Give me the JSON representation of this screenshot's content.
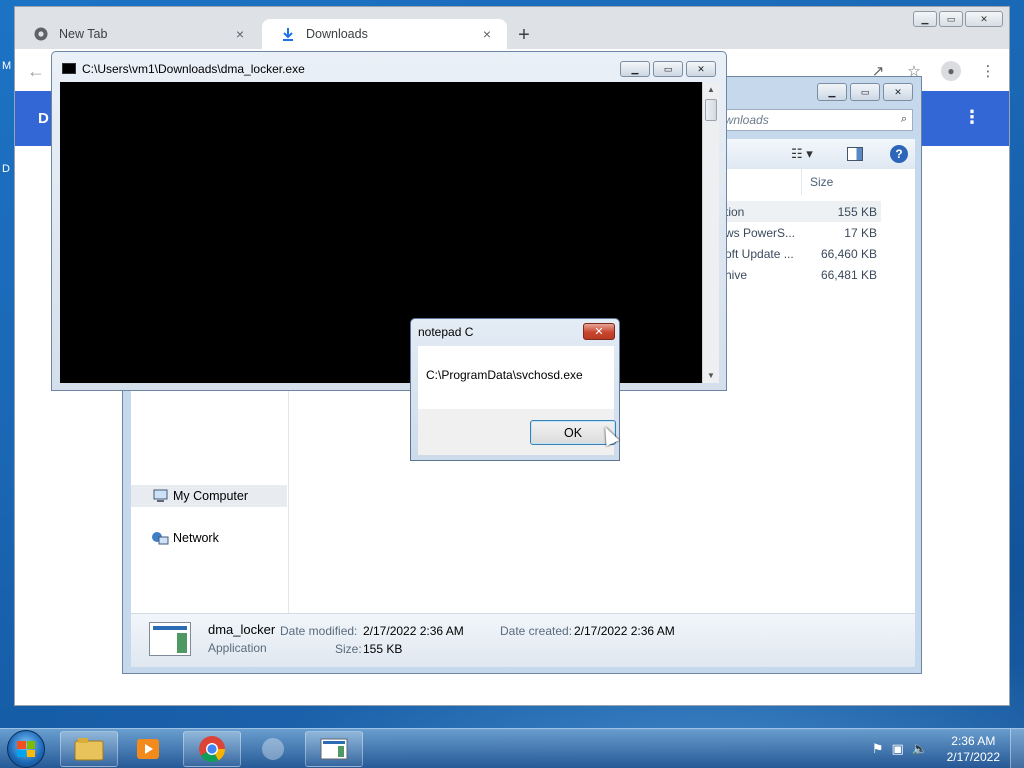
{
  "desktop": {
    "label_1": "M",
    "label_2": "D"
  },
  "chrome": {
    "tabs": [
      {
        "label": "New Tab",
        "close": "×"
      },
      {
        "label": "Downloads",
        "close": "×"
      }
    ],
    "new_tab": "+",
    "header_letter": "D",
    "header_menu": "⋮"
  },
  "explorer": {
    "search_placeholder": "ownloads",
    "size_header": "Size",
    "rows": [
      {
        "name": "tion",
        "size": "155 KB"
      },
      {
        "name": "ws PowerS...",
        "size": "17 KB"
      },
      {
        "name": "oft Update ...",
        "size": "66,460 KB"
      },
      {
        "name": "hive",
        "size": "66,481 KB"
      }
    ],
    "nav": [
      {
        "label": "My Computer"
      },
      {
        "label": "Network"
      }
    ],
    "details": {
      "name": "dma_locker",
      "type": "Application",
      "modified_label": "Date modified:",
      "modified_value": "2/17/2022 2:36 AM",
      "created_label": "Date created:",
      "created_value": "2/17/2022 2:36 AM",
      "size_label": "Size:",
      "size_value": "155 KB"
    }
  },
  "console": {
    "title": "C:\\Users\\vm1\\Downloads\\dma_locker.exe"
  },
  "msgbox": {
    "title": "notepad C",
    "message": "C:\\ProgramData\\svchosd.exe",
    "ok_label": "OK",
    "close": "✕"
  },
  "taskbar": {
    "time": "2:36 AM",
    "date": "2/17/2022"
  }
}
